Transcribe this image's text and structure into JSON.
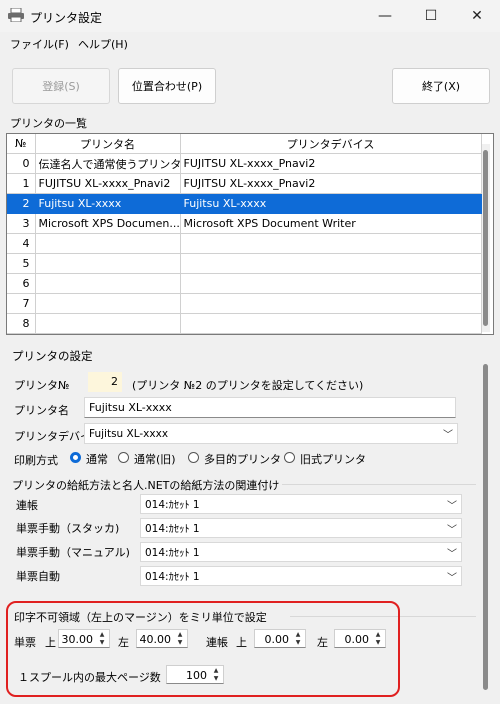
{
  "window": {
    "title": "プリンタ設定",
    "minimize": "—",
    "maximize": "☐",
    "close": "✕"
  },
  "menu": {
    "file": "ファイル(F)",
    "help": "ヘルプ(H)"
  },
  "toolbar": {
    "register": "登録(S)",
    "align": "位置合わせ(P)",
    "exit": "終了(X)"
  },
  "printer_list": {
    "label": "プリンタの一覧",
    "headers": [
      "№",
      "プリンタ名",
      "プリンタデバイス"
    ],
    "rows": [
      {
        "no": "0",
        "name": "伝達名人で通常使うプリンタ",
        "device": "FUJITSU XL-xxxx_Pnavi2"
      },
      {
        "no": "1",
        "name": "FUJITSU XL-xxxx_Pnavi2",
        "device": "FUJITSU XL-xxxx_Pnavi2"
      },
      {
        "no": "2",
        "name": "Fujitsu XL-xxxx",
        "device": "Fujitsu XL-xxxx"
      },
      {
        "no": "3",
        "name": "Microsoft XPS Documen...",
        "device": "Microsoft XPS Document Writer"
      },
      {
        "no": "4",
        "name": "",
        "device": ""
      },
      {
        "no": "5",
        "name": "",
        "device": ""
      },
      {
        "no": "6",
        "name": "",
        "device": ""
      },
      {
        "no": "7",
        "name": "",
        "device": ""
      },
      {
        "no": "8",
        "name": "",
        "device": ""
      }
    ],
    "selected_row": 2
  },
  "settings": {
    "section_label": "プリンタの設定",
    "no_label": "プリンタ№",
    "no_value": "2",
    "no_hint": "(プリンタ №2 のプリンタを設定してください)",
    "name_label": "プリンタ名",
    "name_value": "Fujitsu XL-xxxx",
    "device_label": "プリンタデバイス",
    "device_value": "Fujitsu XL-xxxx",
    "method_label": "印刷方式",
    "methods": [
      "通常",
      "通常(旧)",
      "多目的プリンタ",
      "旧式プリンタ"
    ],
    "selected_method": 0
  },
  "feed": {
    "label": "プリンタの給紙方法と名人.NETの給紙方法の関連付け",
    "rows": [
      {
        "label": "連帳",
        "value": "014:ｶｾｯﾄ 1"
      },
      {
        "label": "単票手動（スタッカ)",
        "value": "014:ｶｾｯﾄ 1"
      },
      {
        "label": "単票手動（マニュアル)",
        "value": "014:ｶｾｯﾄ 1"
      },
      {
        "label": "単票自動",
        "value": "014:ｶｾｯﾄ 1"
      }
    ]
  },
  "margins": {
    "label": "印字不可領域（左上のマージン）をミリ単位で設定",
    "single_label": "単票",
    "top_label": "上",
    "left_label": "左",
    "cont_label": "連帳",
    "single_top": "30.00",
    "single_left": "40.00",
    "cont_top": "0.00",
    "cont_left": "0.00",
    "max_pages_label": "１スプール内の最大ページ数",
    "max_pages": "100"
  },
  "colors": {
    "selection": "#0e6bd7",
    "highlight_border": "#e02020"
  }
}
